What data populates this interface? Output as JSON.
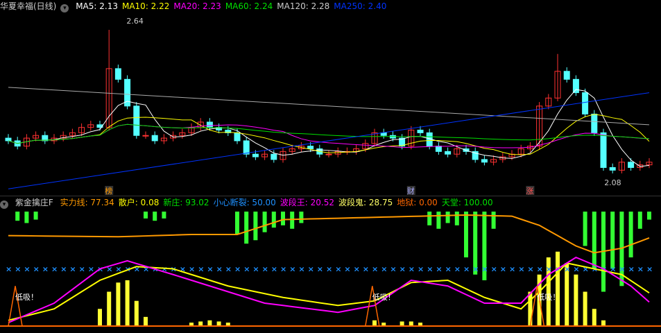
{
  "header": {
    "title": "华夏幸福(日线)",
    "ma": [
      {
        "label": "MA5: 2.13",
        "color": "#ffffff"
      },
      {
        "label": "MA10: 2.22",
        "color": "#ffff00"
      },
      {
        "label": "MA20: 2.23",
        "color": "#ff00ff"
      },
      {
        "label": "MA60: 2.24",
        "color": "#00e000"
      },
      {
        "label": "MA120: 2.28",
        "color": "#cccccc"
      },
      {
        "label": "MA250: 2.40",
        "color": "#0033ff"
      }
    ]
  },
  "indicator": {
    "title": "紫金擒庄F",
    "items": [
      {
        "label": "实力线: 77.34",
        "color": "#ff9900"
      },
      {
        "label": "散户: 0.08",
        "color": "#ffff00"
      },
      {
        "label": "新庄: 93.02",
        "color": "#00e000"
      },
      {
        "label": "小心断裂: 50.00",
        "color": "#1e90ff"
      },
      {
        "label": "波段王: 20.52",
        "color": "#ff00ff"
      },
      {
        "label": "波段鬼: 28.75",
        "color": "#ffff66"
      },
      {
        "label": "地狱: 0.00",
        "color": "#ff6600"
      },
      {
        "label": "天堂: 100.00",
        "color": "#00e000"
      }
    ],
    "signal_label": "低吸！",
    "signals": [
      0,
      39,
      57
    ]
  },
  "annotations": {
    "high": "2.64",
    "low": "2.08",
    "markers": [
      {
        "text": "榜",
        "index": 11
      },
      {
        "text": "财",
        "index": 44
      },
      {
        "text": "涨",
        "index": 57
      }
    ]
  },
  "chart_data": {
    "type": "candlestick",
    "closes": [
      2.22,
      2.2,
      2.23,
      2.24,
      2.22,
      2.23,
      2.24,
      2.25,
      2.27,
      2.28,
      2.27,
      2.49,
      2.45,
      2.35,
      2.24,
      2.24,
      2.22,
      2.23,
      2.24,
      2.25,
      2.27,
      2.29,
      2.27,
      2.26,
      2.25,
      2.22,
      2.17,
      2.16,
      2.17,
      2.15,
      2.18,
      2.19,
      2.2,
      2.19,
      2.17,
      2.17,
      2.18,
      2.18,
      2.19,
      2.21,
      2.25,
      2.24,
      2.23,
      2.2,
      2.26,
      2.25,
      2.2,
      2.18,
      2.17,
      2.19,
      2.18,
      2.15,
      2.14,
      2.15,
      2.16,
      2.17,
      2.19,
      2.2,
      2.35,
      2.38,
      2.48,
      2.45,
      2.4,
      2.32,
      2.25,
      2.12,
      2.11,
      2.14,
      2.12,
      2.13,
      2.14
    ],
    "price_range": [
      2.02,
      2.7
    ],
    "ma120": [
      2.42,
      2.28
    ],
    "ma250": [
      2.04,
      2.4
    ],
    "indicator_range": [
      0,
      100
    ],
    "strength": [
      [
        0,
        79
      ],
      [
        12,
        78
      ],
      [
        20,
        80
      ],
      [
        25,
        80
      ],
      [
        30,
        93
      ],
      [
        40,
        95
      ],
      [
        50,
        97
      ],
      [
        55,
        96
      ],
      [
        58,
        88
      ],
      [
        62,
        70
      ],
      [
        64,
        64
      ],
      [
        67,
        68
      ],
      [
        70,
        77
      ]
    ],
    "ghost": [
      [
        0,
        5
      ],
      [
        5,
        15
      ],
      [
        10,
        40
      ],
      [
        14,
        52
      ],
      [
        18,
        50
      ],
      [
        24,
        35
      ],
      [
        30,
        25
      ],
      [
        36,
        18
      ],
      [
        40,
        22
      ],
      [
        44,
        38
      ],
      [
        48,
        40
      ],
      [
        52,
        25
      ],
      [
        56,
        15
      ],
      [
        58,
        30
      ],
      [
        61,
        55
      ],
      [
        64,
        50
      ],
      [
        67,
        45
      ],
      [
        70,
        29
      ]
    ],
    "king": [
      [
        0,
        3
      ],
      [
        5,
        20
      ],
      [
        10,
        50
      ],
      [
        13,
        57
      ],
      [
        18,
        45
      ],
      [
        24,
        30
      ],
      [
        28,
        20
      ],
      [
        36,
        12
      ],
      [
        40,
        18
      ],
      [
        44,
        40
      ],
      [
        48,
        35
      ],
      [
        52,
        20
      ],
      [
        56,
        20
      ],
      [
        59,
        45
      ],
      [
        62,
        60
      ],
      [
        65,
        50
      ],
      [
        68,
        35
      ],
      [
        70,
        21
      ]
    ],
    "green_bars": [
      [
        1,
        92
      ],
      [
        2,
        90
      ],
      [
        3,
        93
      ],
      [
        15,
        94
      ],
      [
        16,
        92
      ],
      [
        17,
        94
      ],
      [
        25,
        80
      ],
      [
        26,
        72
      ],
      [
        27,
        75
      ],
      [
        28,
        82
      ],
      [
        29,
        86
      ],
      [
        30,
        88
      ],
      [
        31,
        85
      ],
      [
        32,
        90
      ],
      [
        46,
        88
      ],
      [
        47,
        85
      ],
      [
        48,
        90
      ],
      [
        49,
        88
      ],
      [
        50,
        60
      ],
      [
        51,
        45
      ],
      [
        52,
        40
      ],
      [
        53,
        85
      ],
      [
        63,
        70
      ],
      [
        64,
        50
      ],
      [
        65,
        30
      ],
      [
        66,
        50
      ],
      [
        67,
        35
      ],
      [
        68,
        60
      ],
      [
        69,
        85
      ],
      [
        70,
        93
      ]
    ],
    "yellow_bars": [
      [
        10,
        15
      ],
      [
        11,
        30
      ],
      [
        12,
        38
      ],
      [
        13,
        40
      ],
      [
        14,
        22
      ],
      [
        15,
        8
      ],
      [
        20,
        3
      ],
      [
        21,
        4
      ],
      [
        22,
        5
      ],
      [
        23,
        4
      ],
      [
        24,
        3
      ],
      [
        40,
        5
      ],
      [
        41,
        3
      ],
      [
        43,
        4
      ],
      [
        44,
        4
      ],
      [
        45,
        3
      ],
      [
        57,
        30
      ],
      [
        58,
        45
      ],
      [
        59,
        60
      ],
      [
        60,
        65
      ],
      [
        61,
        55
      ],
      [
        62,
        45
      ],
      [
        63,
        30
      ],
      [
        64,
        15
      ],
      [
        65,
        5
      ]
    ],
    "danger_level": 50
  }
}
